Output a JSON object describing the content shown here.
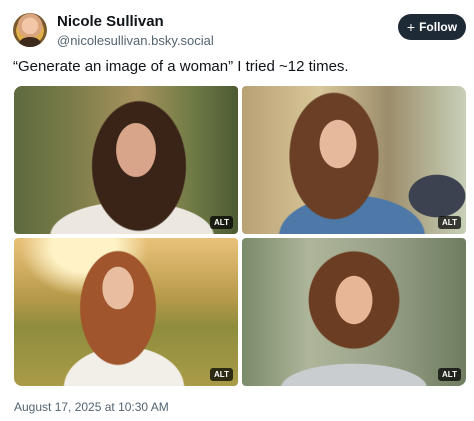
{
  "author": {
    "display_name": "Nicole Sullivan",
    "handle": "@nicolesullivan.bsky.social",
    "avatar_icon": "avatar-photo"
  },
  "follow_button": {
    "icon": "plus-icon",
    "icon_glyph": "+",
    "label": "Follow",
    "background": "#1f2a37"
  },
  "post": {
    "text": "“Generate an image of a woman” I tried ~12 times.",
    "images": [
      {
        "alt_badge": "ALT"
      },
      {
        "alt_badge": "ALT"
      },
      {
        "alt_badge": "ALT"
      },
      {
        "alt_badge": "ALT"
      }
    ],
    "timestamp": "August 17, 2025 at 10:30 AM"
  }
}
